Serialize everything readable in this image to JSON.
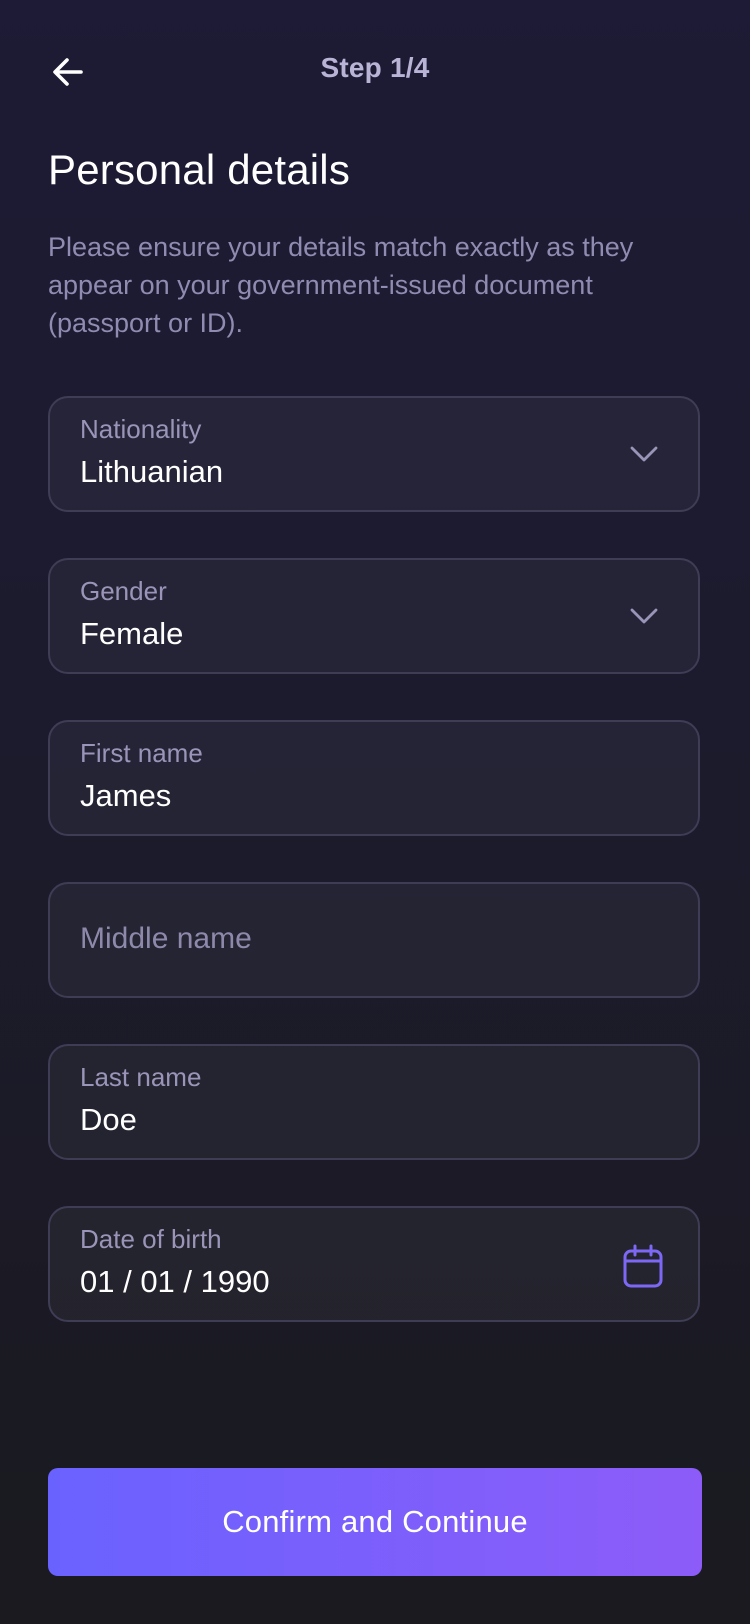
{
  "header": {
    "step": "Step 1/4",
    "back_icon": "arrow-left-icon"
  },
  "page": {
    "title": "Personal details",
    "subtitle": "Please ensure your details match exactly as they appear on your government-issued document (passport or ID)."
  },
  "form": {
    "nationality": {
      "label": "Nationality",
      "value": "Lithuanian",
      "icon": "chevron-down-icon"
    },
    "gender": {
      "label": "Gender",
      "value": "Female",
      "icon": "chevron-down-icon"
    },
    "first_name": {
      "label": "First name",
      "value": "James"
    },
    "middle_name": {
      "placeholder": "Middle name"
    },
    "last_name": {
      "label": "Last name",
      "value": "Doe"
    },
    "date_of_birth": {
      "label": "Date of birth",
      "value": "01 / 01 / 1990",
      "icon": "calendar-icon"
    }
  },
  "actions": {
    "confirm_label": "Confirm and Continue"
  },
  "colors": {
    "accent_start": "#6a62ff",
    "accent_end": "#8d5cf8",
    "calendar_icon": "#7c68f5"
  }
}
